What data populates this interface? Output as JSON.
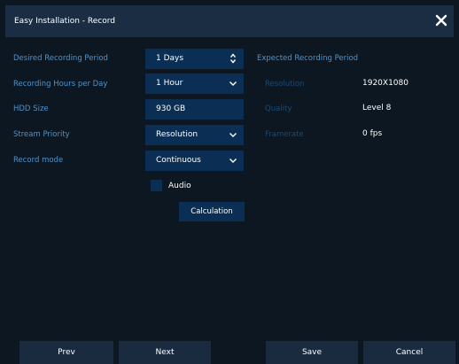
{
  "window": {
    "title": "Easy Installation - Record"
  },
  "form": {
    "period": {
      "label": "Desired Recording Period",
      "value": "1 Days"
    },
    "hours": {
      "label": "Recording Hours per Day",
      "value": "1 Hour"
    },
    "hdd": {
      "label": "HDD Size",
      "value": "930 GB"
    },
    "stream": {
      "label": "Stream Priority",
      "value": "Resolution"
    },
    "mode": {
      "label": "Record mode",
      "value": "Continuous"
    },
    "audio": {
      "label": "Audio",
      "checked": false
    },
    "calculation_label": "Calculation"
  },
  "expected": {
    "title": "Expected Recording Period",
    "rows": [
      {
        "label": "Resolution",
        "value": "1920X1080"
      },
      {
        "label": "Quality",
        "value": "Level 8"
      },
      {
        "label": "Framerate",
        "value": "0 fps"
      }
    ]
  },
  "footer": {
    "prev": "Prev",
    "next": "Next",
    "save": "Save",
    "cancel": "Cancel"
  },
  "colors": {
    "background": "#0c1722",
    "titlebar": "#1b2d42",
    "control": "#0b2f54",
    "label": "#4f93c9",
    "disabled_label": "#1c4a73",
    "button": "#1a2b40"
  }
}
